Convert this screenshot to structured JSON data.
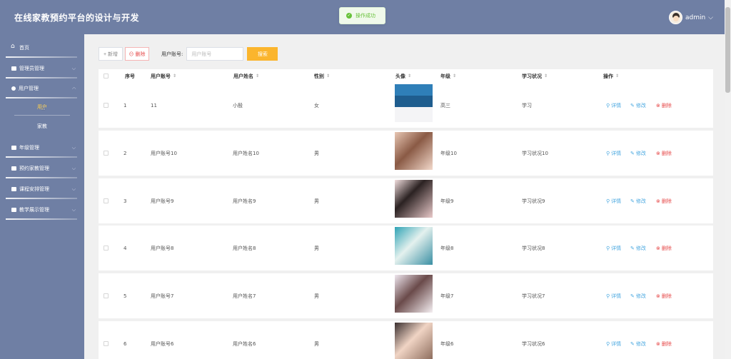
{
  "header": {
    "title": "在线家教预约平台的设计与开发",
    "username": "admin",
    "dropdown_icon": "chevron-down-icon"
  },
  "toast": {
    "message": "操作成功"
  },
  "sidebar": {
    "items": [
      {
        "label": "首页",
        "icon": "home-icon"
      },
      {
        "label": "管理员管理",
        "icon": "table-icon"
      },
      {
        "label": "用户管理",
        "icon": "user-icon"
      },
      {
        "label": "年级管理",
        "icon": "table-icon"
      },
      {
        "label": "预约家教管理",
        "icon": "table-icon"
      },
      {
        "label": "课程安排管理",
        "icon": "table-icon"
      },
      {
        "label": "教学展示管理",
        "icon": "table-icon"
      }
    ],
    "sub_items": [
      {
        "label": "用户"
      },
      {
        "label": "家教"
      }
    ]
  },
  "toolbar": {
    "add_label": "+ 新增",
    "delete_label": "⊖ 删除",
    "search_label": "用户账号:",
    "search_placeholder": "用户账号",
    "search_button": "搜索"
  },
  "table": {
    "columns": [
      "序号",
      "用户账号",
      "用户姓名",
      "性别",
      "头像",
      "年级",
      "学习状况",
      "操作"
    ],
    "actions": {
      "detail": "详情",
      "edit": "修改",
      "delete": "删除"
    },
    "rows": [
      {
        "index": "1",
        "account": "11",
        "name": "小殷",
        "gender": "女",
        "grade": "高三",
        "status": "学习"
      },
      {
        "index": "2",
        "account": "用户账号10",
        "name": "用户姓名10",
        "gender": "男",
        "grade": "年级10",
        "status": "学习状况10"
      },
      {
        "index": "3",
        "account": "用户账号9",
        "name": "用户姓名9",
        "gender": "男",
        "grade": "年级9",
        "status": "学习状况9"
      },
      {
        "index": "4",
        "account": "用户账号8",
        "name": "用户姓名8",
        "gender": "男",
        "grade": "年级8",
        "status": "学习状况8"
      },
      {
        "index": "5",
        "account": "用户账号7",
        "name": "用户姓名7",
        "gender": "男",
        "grade": "年级7",
        "status": "学习状况7"
      },
      {
        "index": "6",
        "account": "用户账号6",
        "name": "用户姓名6",
        "gender": "男",
        "grade": "年级6",
        "status": "学习状况6"
      }
    ]
  },
  "colors": {
    "sidebar_bg": "#6f7fa4",
    "accent": "#fbb52d",
    "active_submenu": "#ffd04b",
    "link": "#4aa8e0",
    "danger": "#e64a4a",
    "success": "#67c23a"
  }
}
